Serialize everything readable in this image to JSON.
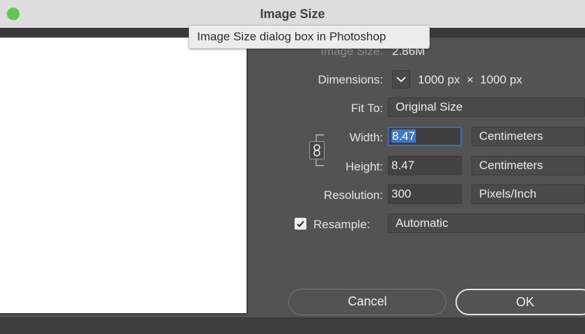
{
  "window": {
    "title": "Image Size"
  },
  "tooltip": {
    "text": "Image Size dialog box in Photoshop"
  },
  "image_size": {
    "label": "Image Size:",
    "value": "2.86M"
  },
  "dimensions": {
    "label": "Dimensions:",
    "value": "1000 px  ×  1000 px"
  },
  "fit_to": {
    "label": "Fit To:",
    "value": "Original Size"
  },
  "width": {
    "label": "Width:",
    "value": "8.47",
    "unit": "Centimeters"
  },
  "height": {
    "label": "Height:",
    "value": "8.47",
    "unit": "Centimeters"
  },
  "resolution": {
    "label": "Resolution:",
    "value": "300",
    "unit": "Pixels/Inch"
  },
  "resample": {
    "label": "Resample:",
    "checked": true,
    "value": "Automatic"
  },
  "buttons": {
    "cancel": "Cancel",
    "ok": "OK"
  },
  "colors": {
    "traffic_light_green": "#5ec84d",
    "focus_blue": "#2f6fbd",
    "dialog_bg": "#535353"
  },
  "icons": [
    "chevron-down-icon",
    "link-icon",
    "checkmark-icon"
  ]
}
